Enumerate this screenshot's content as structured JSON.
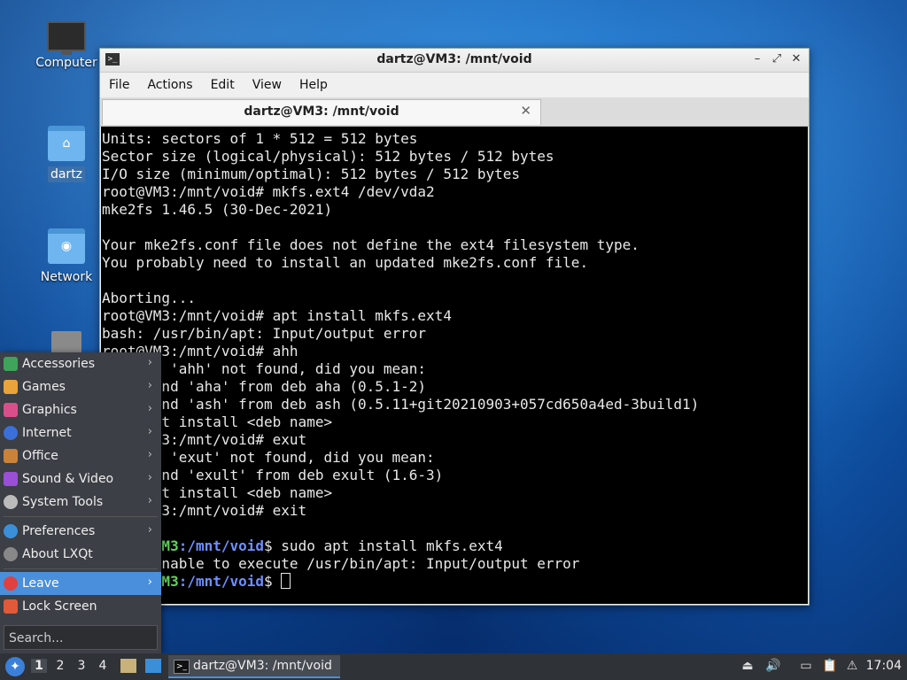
{
  "desktop": {
    "icons": [
      {
        "label": "Computer"
      },
      {
        "label": "dartz"
      },
      {
        "label": "Network"
      },
      {
        "label": "Trash"
      }
    ]
  },
  "window": {
    "title": "dartz@VM3: /mnt/void",
    "menu": [
      "File",
      "Actions",
      "Edit",
      "View",
      "Help"
    ],
    "tab_title": "dartz@VM3: /mnt/void",
    "terminal": {
      "lines": [
        "Units: sectors of 1 * 512 = 512 bytes",
        "Sector size (logical/physical): 512 bytes / 512 bytes",
        "I/O size (minimum/optimal): 512 bytes / 512 bytes",
        "root@VM3:/mnt/void# mkfs.ext4 /dev/vda2",
        "mke2fs 1.46.5 (30-Dec-2021)",
        "",
        "Your mke2fs.conf file does not define the ext4 filesystem type.",
        "You probably need to install an updated mke2fs.conf file.",
        "",
        "Aborting...",
        "root@VM3:/mnt/void# apt install mkfs.ext4",
        "bash: /usr/bin/apt: Input/output error",
        "root@VM3:/mnt/void# ahh",
        "Command 'ahh' not found, did you mean:",
        "  command 'aha' from deb aha (0.5.1-2)",
        "  command 'ash' from deb ash (0.5.11+git20210903+057cd650a4ed-3build1)",
        "Try: apt install <deb name>",
        "root@VM3:/mnt/void# exut",
        "Command 'exut' not found, did you mean:",
        "  command 'exult' from deb exult (1.6-3)",
        "Try: apt install <deb name>",
        "root@VM3:/mnt/void# exit",
        ""
      ],
      "prompt_user": "dartz@VM3",
      "prompt_path": ":/mnt/void",
      "prompt_end": "$ ",
      "cmd1": "sudo apt install mkfs.ext4",
      "error_line": "sudo: unable to execute /usr/bin/apt: Input/output error",
      "cmd2": ""
    }
  },
  "start_menu": {
    "items": [
      {
        "label": "Accessories",
        "color": "#3fa35b"
      },
      {
        "label": "Games",
        "color": "#e8a33a"
      },
      {
        "label": "Graphics",
        "color": "#d94f8c"
      },
      {
        "label": "Internet",
        "color": "#3b6fd9"
      },
      {
        "label": "Office",
        "color": "#c9823a"
      },
      {
        "label": "Sound & Video",
        "color": "#9a4fd6"
      },
      {
        "label": "System Tools",
        "color": "#bbbbbb"
      }
    ],
    "prefs": "Preferences",
    "about": "About LXQt",
    "leave": "Leave",
    "lock": "Lock Screen",
    "search_placeholder": "Search..."
  },
  "taskbar": {
    "desktops": [
      "1",
      "2",
      "3",
      "4"
    ],
    "task_label": "dartz@VM3: /mnt/void",
    "clock": "17:04"
  }
}
